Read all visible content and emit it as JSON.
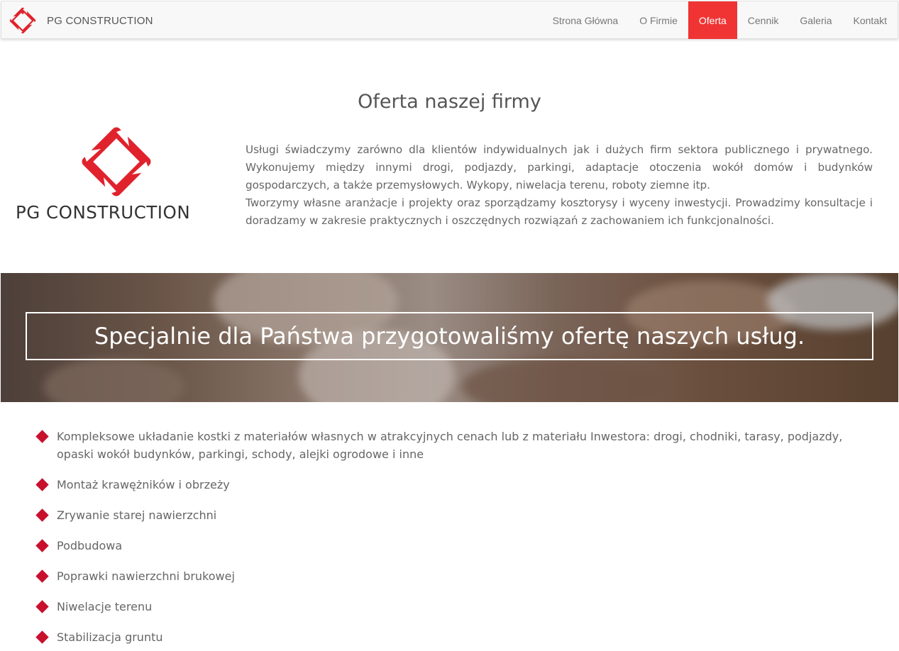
{
  "brand": {
    "name": "PG CONSTRUCTION",
    "logo_icon": "pg-diamond-logo-icon"
  },
  "colors": {
    "accent": "#f03434",
    "logo_red": "#e0222c",
    "bullet": "#c8102e"
  },
  "nav": {
    "items": [
      {
        "label": "Strona Główna",
        "active": false
      },
      {
        "label": "O Firmie",
        "active": false
      },
      {
        "label": "Oferta",
        "active": true
      },
      {
        "label": "Cennik",
        "active": false
      },
      {
        "label": "Galeria",
        "active": false
      },
      {
        "label": "Kontakt",
        "active": false
      }
    ]
  },
  "main": {
    "title": "Oferta naszej firmy",
    "logo_text": "PG  CONSTRUCTION",
    "intro": [
      "Usługi świadczymy zarówno dla klientów indywidualnych jak i dużych firm sektora publicznego i prywatnego. Wykonujemy między innymi drogi, podjazdy, parkingi, adaptacje otoczenia wokół domów i budynków gospodarczych, a także przemysłowych. Wykopy, niwelacja terenu, roboty ziemne itp.",
      "Tworzymy własne aranżacje i projekty oraz sporządzamy kosztorysy i wyceny inwestycji. Prowadzimy konsultacje i doradzamy w zakresie praktycznych i oszczędnych rozwiązań z zachowaniem ich funkcjonalności."
    ]
  },
  "banner": {
    "text": "Specjalnie dla Państwa przygotowaliśmy ofertę naszych usług."
  },
  "services": [
    "Kompleksowe układanie kostki z materiałów własnych w atrakcyjnych cenach lub z materiału Inwestora: drogi, chodniki, tarasy, podjazdy, opaski wokół budynków, parkingi, schody, alejki ogrodowe i inne",
    "Montaż krawężników i obrzeży",
    "Zrywanie starej nawierzchni",
    "Podbudowa",
    "Poprawki nawierzchni brukowej",
    "Niwelacje terenu",
    "Stabilizacja gruntu"
  ]
}
